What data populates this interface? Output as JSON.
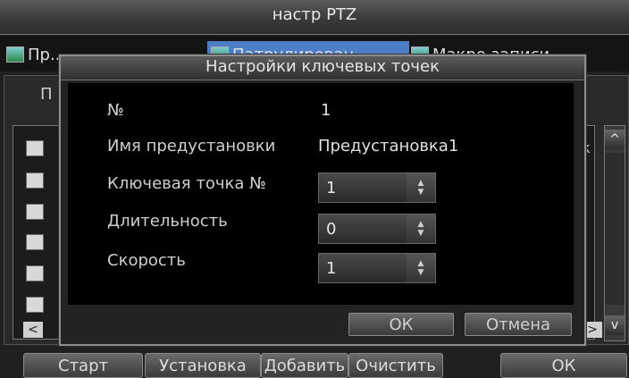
{
  "window": {
    "title": "настр PTZ"
  },
  "tabs": [
    {
      "label": "Пр...",
      "icon": "image-icon"
    },
    {
      "label": "Патрулирован",
      "icon": "image-icon"
    },
    {
      "label": "Макро  записи",
      "icon": "image-icon"
    }
  ],
  "panel": {
    "label": "П",
    "column_fragment": "к",
    "checkboxes": 6
  },
  "scroll": {
    "up": "^",
    "down": "v",
    "left": "<",
    "right": ">"
  },
  "bottom_buttons": {
    "start": "Старт",
    "setup": "Установка",
    "add": "Добавить",
    "clear": "Очистить",
    "ok": "ОК"
  },
  "dialog": {
    "title": "Настройки ключевых точек",
    "fields": {
      "number": {
        "label": "№",
        "value": "1"
      },
      "preset_name": {
        "label": "Имя предустановки",
        "value": "Предустановка1"
      },
      "keypoint": {
        "label": "Ключевая точка №",
        "value": "1"
      },
      "duration": {
        "label": "Длительность",
        "value": "0"
      },
      "speed": {
        "label": "Скорость",
        "value": "1"
      }
    },
    "ok_label": "ОК",
    "cancel_label": "Отмена"
  },
  "colors": {
    "accent_tab": "#4d7fc8",
    "background": "#1e1e1e",
    "dialog_body": "#000000"
  }
}
